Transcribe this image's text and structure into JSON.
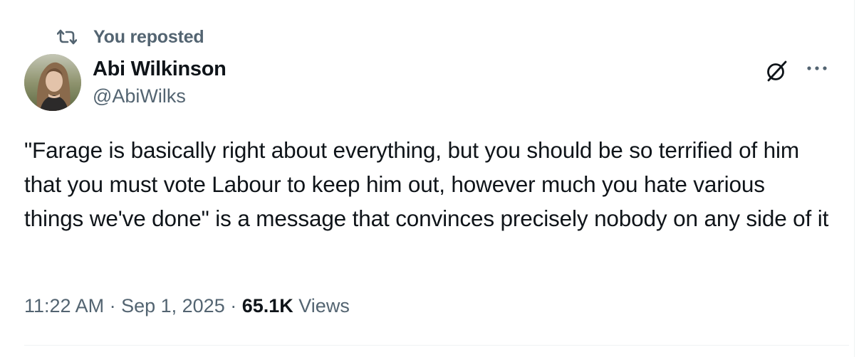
{
  "repost": {
    "label": "You reposted",
    "icon": "repost-icon"
  },
  "author": {
    "display_name": "Abi Wilkinson",
    "handle": "@AbiWilks",
    "avatar": "avatar"
  },
  "actions": {
    "grok_icon": "grok-icon",
    "more_icon": "more-icon"
  },
  "tweet": {
    "text": "\"Farage is basically right about everything, but you should be so terrified of him that you must vote Labour to keep him out, however much you hate various things we've done\" is a message that convinces precisely nobody on any side of it"
  },
  "meta": {
    "time": "11:22 AM",
    "separator": " · ",
    "date": "Sep 1, 2025",
    "views_count": "65.1K",
    "views_label": " Views"
  },
  "colors": {
    "text_primary": "#0f1419",
    "text_secondary": "#536471",
    "border": "#eff3f4"
  }
}
